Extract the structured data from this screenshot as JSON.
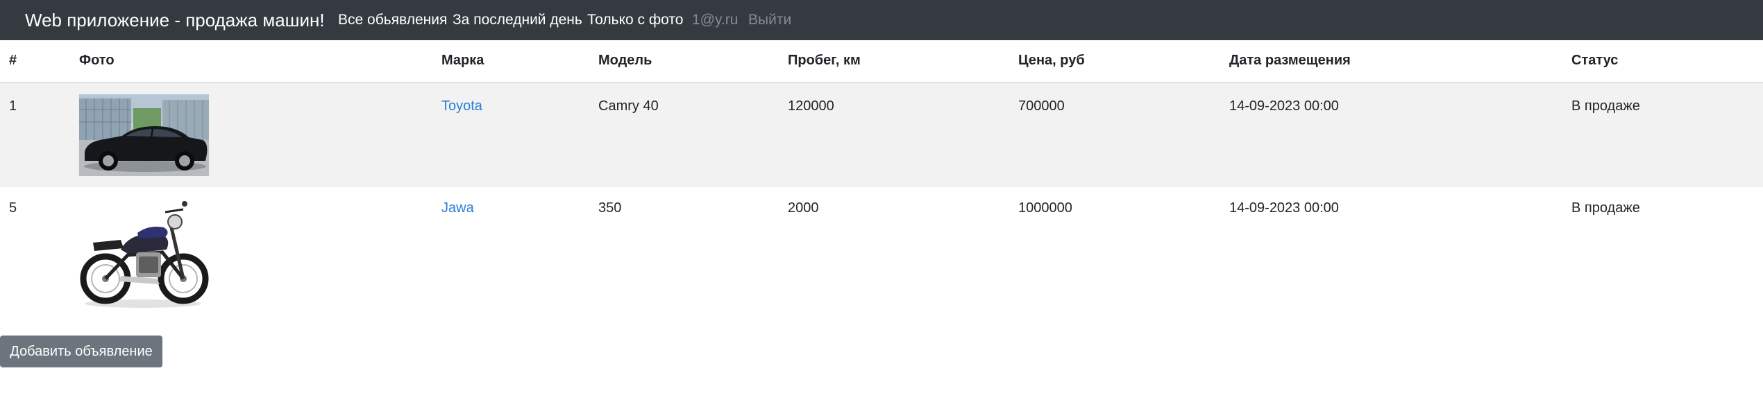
{
  "navbar": {
    "brand": "Web приложение - продажа машин!",
    "links": [
      {
        "label": "Все обьявления"
      },
      {
        "label": "За последний день"
      },
      {
        "label": "Только с фото"
      },
      {
        "label": "1@y.ru"
      },
      {
        "label": "Выйти"
      }
    ]
  },
  "table": {
    "headers": [
      "#",
      "Фото",
      "Марка",
      "Модель",
      "Пробег, км",
      "Цена, руб",
      "Дата размещения",
      "Статус"
    ],
    "rows": [
      {
        "id": "1",
        "photo": "black-sedan-photo",
        "brand": "Toyota",
        "model": "Camry 40",
        "mileage": "120000",
        "price": "700000",
        "date": "14-09-2023 00:00",
        "status": "В продаже"
      },
      {
        "id": "5",
        "photo": "motorcycle-photo",
        "brand": "Jawa",
        "model": "350",
        "mileage": "2000",
        "price": "1000000",
        "date": "14-09-2023 00:00",
        "status": "В продаже"
      }
    ]
  },
  "actions": {
    "add_label": "Добавить объявление"
  },
  "colors": {
    "navbar": "#343a40",
    "link": "#2a7fd4",
    "button": "#6c757d",
    "striped_row": "#f2f2f2"
  }
}
